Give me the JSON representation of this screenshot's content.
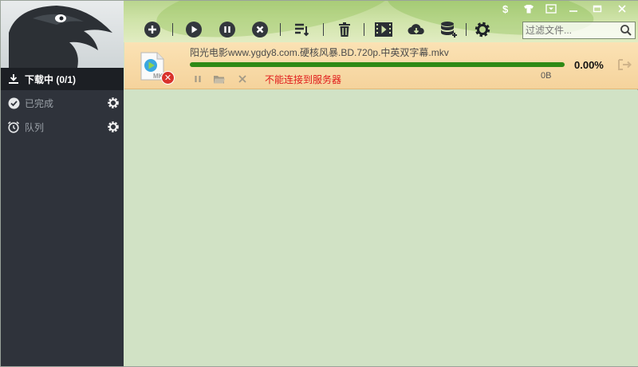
{
  "sidebar": {
    "items": [
      {
        "label": "下载中 (0/1)",
        "icon": "download-icon",
        "active": true
      },
      {
        "label": "已完成",
        "icon": "check-circle-icon",
        "active": false
      },
      {
        "label": "队列",
        "icon": "alarm-clock-icon",
        "active": false
      }
    ]
  },
  "toolbar": {
    "buttons": [
      "add",
      "start",
      "pause",
      "stop",
      "sort",
      "delete",
      "video-convert",
      "cloud-download",
      "database",
      "settings"
    ]
  },
  "search": {
    "placeholder": "过滤文件...",
    "value": ""
  },
  "window_controls": [
    "dollar",
    "skin",
    "dropdown",
    "minimize",
    "maximize",
    "close"
  ],
  "task": {
    "filename": "阳光电影www.ygdy8.com.硬核风暴.BD.720p.中英双字幕.mkv",
    "progress_text": "0.00%",
    "progress_fraction": 0.0,
    "size": "0B",
    "error": "不能连接到服务器",
    "file_icon_label": "MK"
  },
  "colors": {
    "sidebar_bg": "#2f333b",
    "content_bg": "#d1e2c5",
    "progress": "#2f8a15",
    "error": "#e01a1a"
  }
}
